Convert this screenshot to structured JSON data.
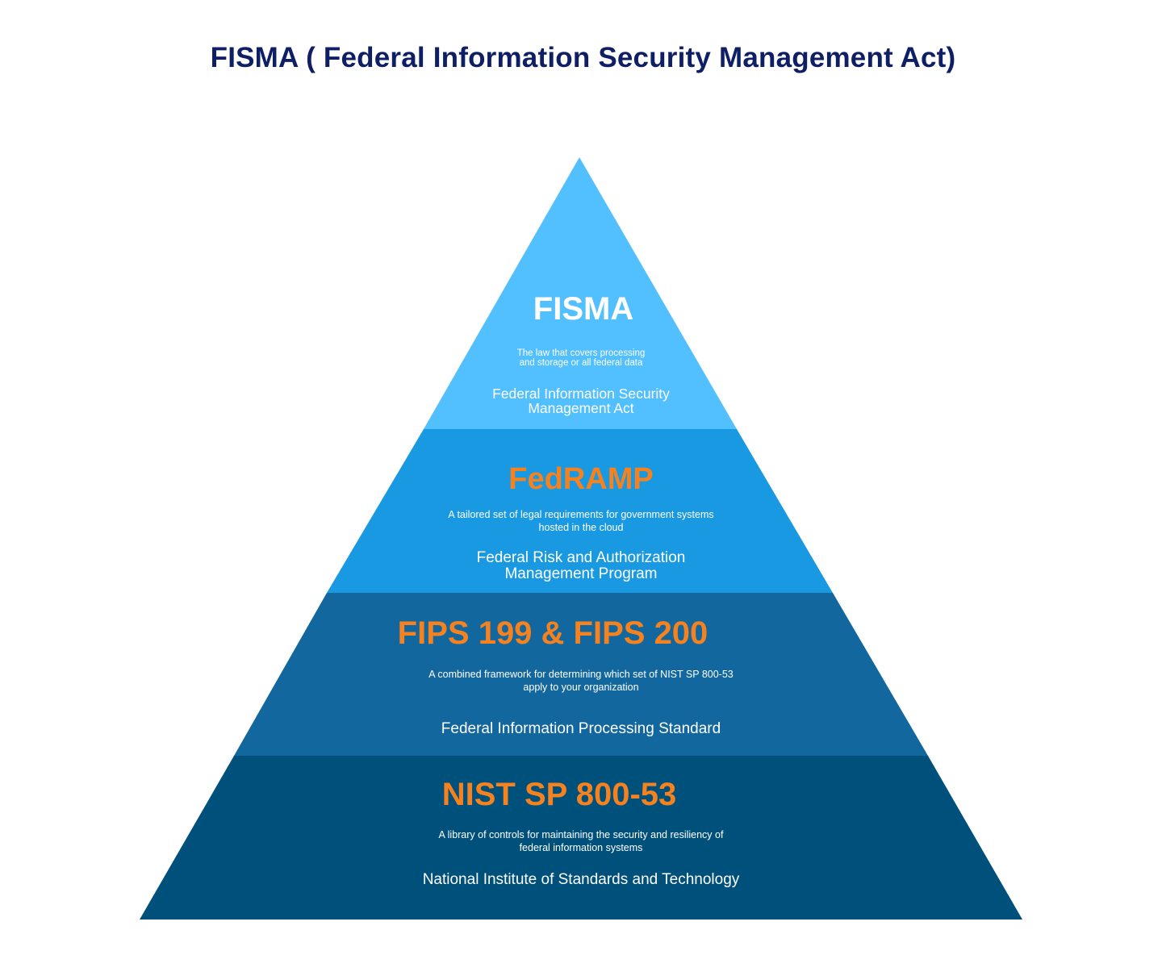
{
  "title": "FISMA ( Federal Information Security Management Act)",
  "colors": {
    "title": "#0f1f66",
    "accent_heading": "#f5821f",
    "white_heading": "#ffffff",
    "tier1": "#52bfff",
    "tier2": "#1a99e3",
    "tier3": "#11679e",
    "tier4": "#00507c"
  },
  "pyramid": {
    "tiers": [
      {
        "name": "FISMA",
        "description": [
          "The law that covers processing",
          "and storage or all federal data"
        ],
        "subtitle": [
          "Federal Information Security",
          "Management Act"
        ]
      },
      {
        "name": "FedRAMP",
        "description": [
          "A tailored set of legal requirements for government systems",
          "hosted in the cloud"
        ],
        "subtitle": [
          "Federal Risk and Authorization",
          "Management Program"
        ]
      },
      {
        "name": "FIPS 199 & FIPS 200",
        "description": [
          "A combined framework for determining which set of NIST SP 800-53",
          "apply to your organization"
        ],
        "subtitle": [
          "Federal Information Processing Standard"
        ]
      },
      {
        "name": "NIST SP 800-53",
        "description": [
          "A library of controls for maintaining the security and resiliency of",
          "federal information systems"
        ],
        "subtitle": [
          "National Institute of Standards and Technology"
        ]
      }
    ]
  }
}
